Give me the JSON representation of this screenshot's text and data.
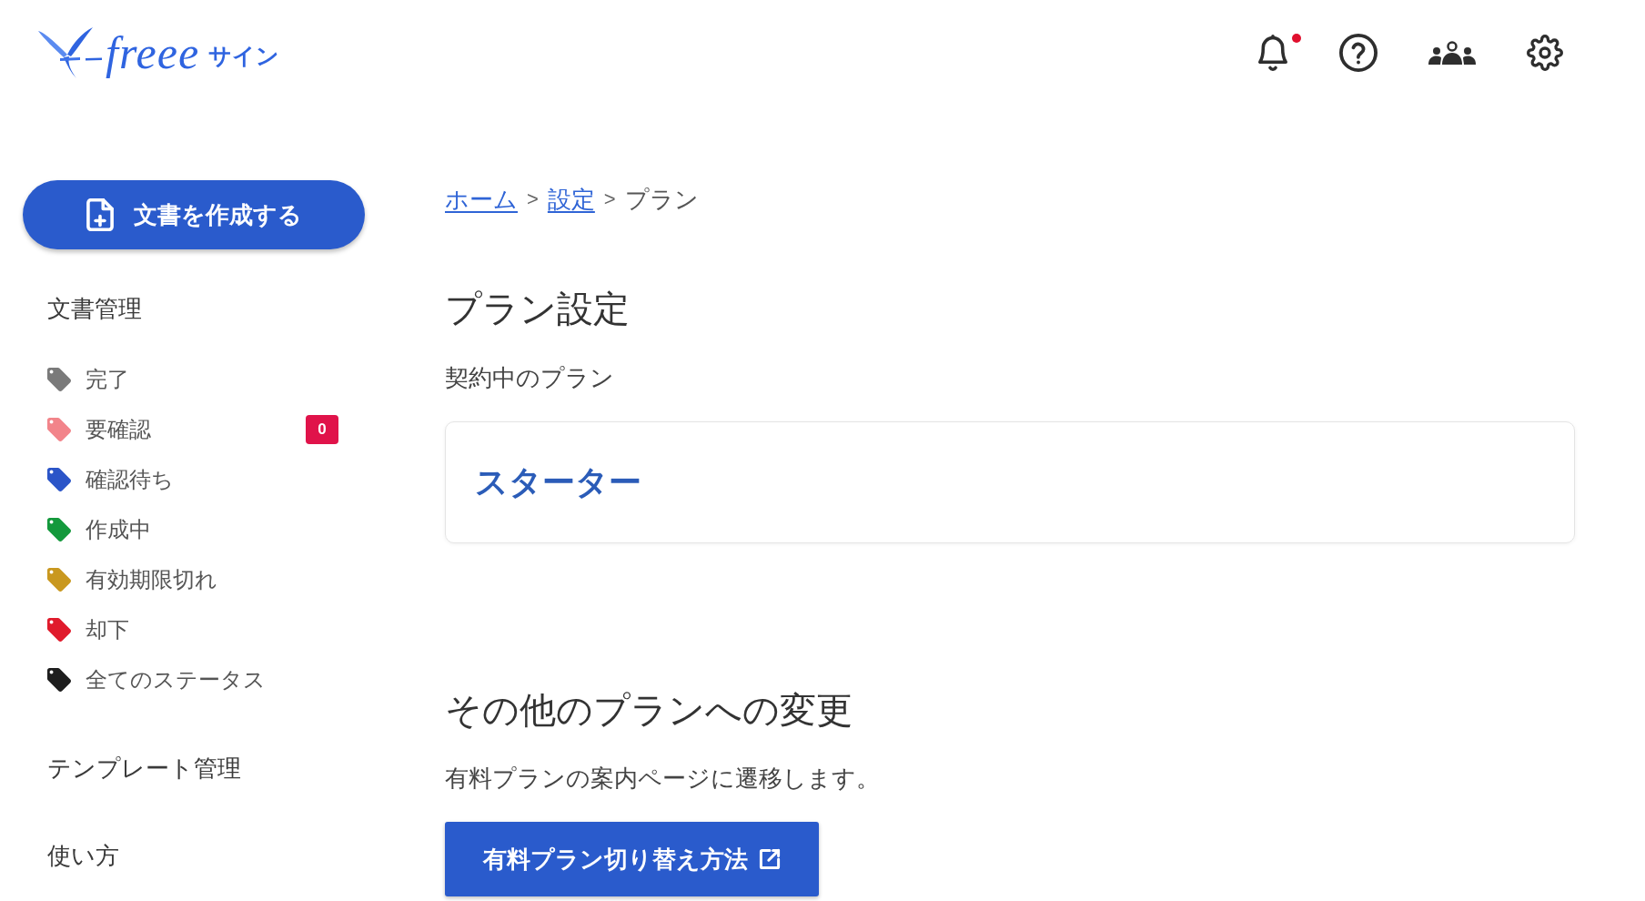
{
  "header": {
    "logo": {
      "wordmark": "freee",
      "product": "サイン"
    },
    "bell": {
      "unread": true
    }
  },
  "sidebar": {
    "create_button": "文書を作成する",
    "sections": [
      {
        "title": "文書管理",
        "items": [
          {
            "label": "完了",
            "color": "#7a7a7a"
          },
          {
            "label": "要確認",
            "color": "#f2848a",
            "badge": "0"
          },
          {
            "label": "確認待ち",
            "color": "#2b55c8"
          },
          {
            "label": "作成中",
            "color": "#14993c"
          },
          {
            "label": "有効期限切れ",
            "color": "#c9981f"
          },
          {
            "label": "却下",
            "color": "#e01b2c"
          },
          {
            "label": "全てのステータス",
            "color": "#1e1e1e"
          }
        ]
      },
      {
        "title": "テンプレート管理"
      },
      {
        "title": "使い方"
      }
    ]
  },
  "breadcrumb": {
    "separator": ">",
    "items": [
      {
        "label": "ホーム",
        "kind": "link"
      },
      {
        "label": "設定",
        "kind": "link"
      },
      {
        "label": "プラン",
        "kind": "current"
      }
    ]
  },
  "plan_section": {
    "title": "プラン設定",
    "label": "契約中のプラン",
    "current_plan": "スターター"
  },
  "change_section": {
    "title": "その他のプランへの変更",
    "description": "有料プランの案内ページに遷移します。",
    "button": "有料プラン切り替え方法"
  }
}
